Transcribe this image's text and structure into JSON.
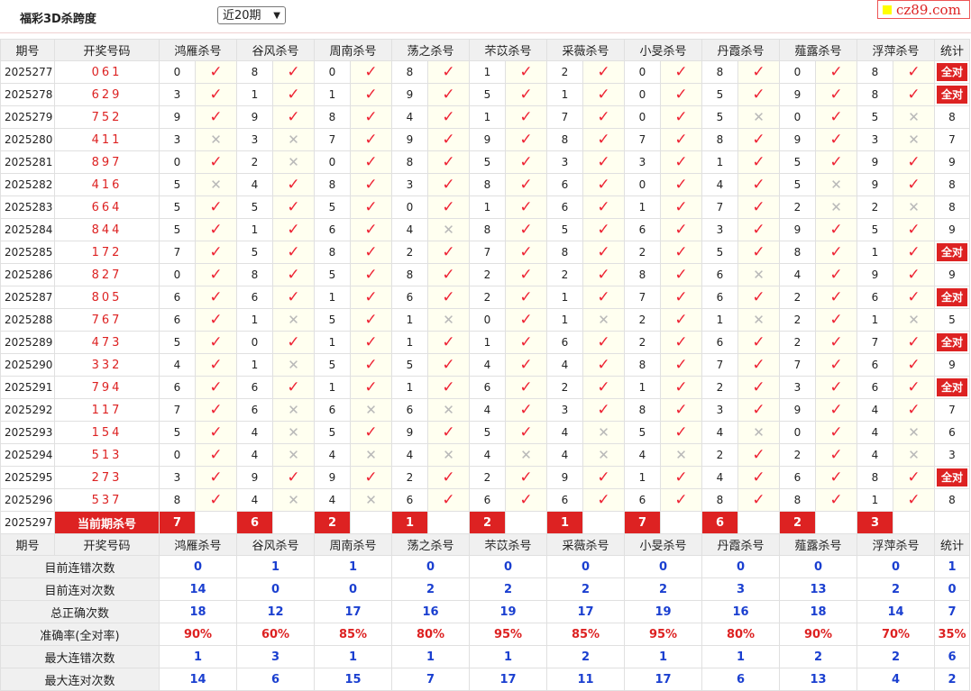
{
  "header": {
    "title": "福彩3D杀跨度",
    "select_value": "近20期",
    "logo_text": "cz89.com"
  },
  "columns": {
    "period": "期号",
    "draw": "开奖号码",
    "experts": [
      "鸿雁杀号",
      "谷风杀号",
      "周南杀号",
      "荡之杀号",
      "芣苡杀号",
      "采薇杀号",
      "小旻杀号",
      "丹霞杀号",
      "薤露杀号",
      "浮萍杀号"
    ],
    "stat": "统计"
  },
  "all_correct_label": "全对",
  "rows": [
    {
      "period": "2025277",
      "draw": "061",
      "kills": [
        [
          0,
          1
        ],
        [
          8,
          1
        ],
        [
          0,
          1
        ],
        [
          8,
          1
        ],
        [
          1,
          1
        ],
        [
          2,
          1
        ],
        [
          0,
          1
        ],
        [
          8,
          1
        ],
        [
          0,
          1
        ],
        [
          8,
          1
        ]
      ],
      "stat": "全对"
    },
    {
      "period": "2025278",
      "draw": "629",
      "kills": [
        [
          3,
          1
        ],
        [
          1,
          1
        ],
        [
          1,
          1
        ],
        [
          9,
          1
        ],
        [
          5,
          1
        ],
        [
          1,
          1
        ],
        [
          0,
          1
        ],
        [
          5,
          1
        ],
        [
          9,
          1
        ],
        [
          8,
          1
        ]
      ],
      "stat": "全对"
    },
    {
      "period": "2025279",
      "draw": "752",
      "kills": [
        [
          9,
          1
        ],
        [
          9,
          1
        ],
        [
          8,
          1
        ],
        [
          4,
          1
        ],
        [
          1,
          1
        ],
        [
          7,
          1
        ],
        [
          0,
          1
        ],
        [
          5,
          0
        ],
        [
          0,
          1
        ],
        [
          5,
          0
        ]
      ],
      "stat": "8"
    },
    {
      "period": "2025280",
      "draw": "411",
      "kills": [
        [
          3,
          0
        ],
        [
          3,
          0
        ],
        [
          7,
          1
        ],
        [
          9,
          1
        ],
        [
          9,
          1
        ],
        [
          8,
          1
        ],
        [
          7,
          1
        ],
        [
          8,
          1
        ],
        [
          9,
          1
        ],
        [
          3,
          0
        ]
      ],
      "stat": "7"
    },
    {
      "period": "2025281",
      "draw": "897",
      "kills": [
        [
          0,
          1
        ],
        [
          2,
          0
        ],
        [
          0,
          1
        ],
        [
          8,
          1
        ],
        [
          5,
          1
        ],
        [
          3,
          1
        ],
        [
          3,
          1
        ],
        [
          1,
          1
        ],
        [
          5,
          1
        ],
        [
          9,
          1
        ]
      ],
      "stat": "9"
    },
    {
      "period": "2025282",
      "draw": "416",
      "kills": [
        [
          5,
          0
        ],
        [
          4,
          1
        ],
        [
          8,
          1
        ],
        [
          3,
          1
        ],
        [
          8,
          1
        ],
        [
          6,
          1
        ],
        [
          0,
          1
        ],
        [
          4,
          1
        ],
        [
          5,
          0
        ],
        [
          9,
          1
        ]
      ],
      "stat": "8"
    },
    {
      "period": "2025283",
      "draw": "664",
      "kills": [
        [
          5,
          1
        ],
        [
          5,
          1
        ],
        [
          5,
          1
        ],
        [
          0,
          1
        ],
        [
          1,
          1
        ],
        [
          6,
          1
        ],
        [
          1,
          1
        ],
        [
          7,
          1
        ],
        [
          2,
          0
        ],
        [
          2,
          0
        ]
      ],
      "stat": "8"
    },
    {
      "period": "2025284",
      "draw": "844",
      "kills": [
        [
          5,
          1
        ],
        [
          1,
          1
        ],
        [
          6,
          1
        ],
        [
          4,
          0
        ],
        [
          8,
          1
        ],
        [
          5,
          1
        ],
        [
          6,
          1
        ],
        [
          3,
          1
        ],
        [
          9,
          1
        ],
        [
          5,
          1
        ]
      ],
      "stat": "9"
    },
    {
      "period": "2025285",
      "draw": "172",
      "kills": [
        [
          7,
          1
        ],
        [
          5,
          1
        ],
        [
          8,
          1
        ],
        [
          2,
          1
        ],
        [
          7,
          1
        ],
        [
          8,
          1
        ],
        [
          2,
          1
        ],
        [
          5,
          1
        ],
        [
          8,
          1
        ],
        [
          1,
          1
        ]
      ],
      "stat": "全对"
    },
    {
      "period": "2025286",
      "draw": "827",
      "kills": [
        [
          0,
          1
        ],
        [
          8,
          1
        ],
        [
          5,
          1
        ],
        [
          8,
          1
        ],
        [
          2,
          1
        ],
        [
          2,
          1
        ],
        [
          8,
          1
        ],
        [
          6,
          0
        ],
        [
          4,
          1
        ],
        [
          9,
          1
        ]
      ],
      "stat": "9"
    },
    {
      "period": "2025287",
      "draw": "805",
      "kills": [
        [
          6,
          1
        ],
        [
          6,
          1
        ],
        [
          1,
          1
        ],
        [
          6,
          1
        ],
        [
          2,
          1
        ],
        [
          1,
          1
        ],
        [
          7,
          1
        ],
        [
          6,
          1
        ],
        [
          2,
          1
        ],
        [
          6,
          1
        ]
      ],
      "stat": "全对"
    },
    {
      "period": "2025288",
      "draw": "767",
      "kills": [
        [
          6,
          1
        ],
        [
          1,
          0
        ],
        [
          5,
          1
        ],
        [
          1,
          0
        ],
        [
          0,
          1
        ],
        [
          1,
          0
        ],
        [
          2,
          1
        ],
        [
          1,
          0
        ],
        [
          2,
          1
        ],
        [
          1,
          0
        ]
      ],
      "stat": "5"
    },
    {
      "period": "2025289",
      "draw": "473",
      "kills": [
        [
          5,
          1
        ],
        [
          0,
          1
        ],
        [
          1,
          1
        ],
        [
          1,
          1
        ],
        [
          1,
          1
        ],
        [
          6,
          1
        ],
        [
          2,
          1
        ],
        [
          6,
          1
        ],
        [
          2,
          1
        ],
        [
          7,
          1
        ]
      ],
      "stat": "全对"
    },
    {
      "period": "2025290",
      "draw": "332",
      "kills": [
        [
          4,
          1
        ],
        [
          1,
          0
        ],
        [
          5,
          1
        ],
        [
          5,
          1
        ],
        [
          4,
          1
        ],
        [
          4,
          1
        ],
        [
          8,
          1
        ],
        [
          7,
          1
        ],
        [
          7,
          1
        ],
        [
          6,
          1
        ]
      ],
      "stat": "9"
    },
    {
      "period": "2025291",
      "draw": "794",
      "kills": [
        [
          6,
          1
        ],
        [
          6,
          1
        ],
        [
          1,
          1
        ],
        [
          1,
          1
        ],
        [
          6,
          1
        ],
        [
          2,
          1
        ],
        [
          1,
          1
        ],
        [
          2,
          1
        ],
        [
          3,
          1
        ],
        [
          6,
          1
        ]
      ],
      "stat": "全对"
    },
    {
      "period": "2025292",
      "draw": "117",
      "kills": [
        [
          7,
          1
        ],
        [
          6,
          0
        ],
        [
          6,
          0
        ],
        [
          6,
          0
        ],
        [
          4,
          1
        ],
        [
          3,
          1
        ],
        [
          8,
          1
        ],
        [
          3,
          1
        ],
        [
          9,
          1
        ],
        [
          4,
          1
        ]
      ],
      "stat": "7"
    },
    {
      "period": "2025293",
      "draw": "154",
      "kills": [
        [
          5,
          1
        ],
        [
          4,
          0
        ],
        [
          5,
          1
        ],
        [
          9,
          1
        ],
        [
          5,
          1
        ],
        [
          4,
          0
        ],
        [
          5,
          1
        ],
        [
          4,
          0
        ],
        [
          0,
          1
        ],
        [
          4,
          0
        ]
      ],
      "stat": "6"
    },
    {
      "period": "2025294",
      "draw": "513",
      "kills": [
        [
          0,
          1
        ],
        [
          4,
          0
        ],
        [
          4,
          0
        ],
        [
          4,
          0
        ],
        [
          4,
          0
        ],
        [
          4,
          0
        ],
        [
          4,
          0
        ],
        [
          2,
          1
        ],
        [
          2,
          1
        ],
        [
          4,
          0
        ]
      ],
      "stat": "3"
    },
    {
      "period": "2025295",
      "draw": "273",
      "kills": [
        [
          3,
          1
        ],
        [
          9,
          1
        ],
        [
          9,
          1
        ],
        [
          2,
          1
        ],
        [
          2,
          1
        ],
        [
          9,
          1
        ],
        [
          1,
          1
        ],
        [
          4,
          1
        ],
        [
          6,
          1
        ],
        [
          8,
          1
        ]
      ],
      "stat": "全对"
    },
    {
      "period": "2025296",
      "draw": "537",
      "kills": [
        [
          8,
          1
        ],
        [
          4,
          0
        ],
        [
          4,
          0
        ],
        [
          6,
          1
        ],
        [
          6,
          1
        ],
        [
          6,
          1
        ],
        [
          6,
          1
        ],
        [
          8,
          1
        ],
        [
          8,
          1
        ],
        [
          1,
          1
        ]
      ],
      "stat": "8"
    }
  ],
  "current": {
    "period": "2025297",
    "label": "当前期杀号",
    "kills": [
      "7",
      "6",
      "2",
      "1",
      "2",
      "1",
      "7",
      "6",
      "2",
      "3"
    ]
  },
  "stats_header": {
    "period": "期号",
    "draw": "开奖号码",
    "stat": "统计"
  },
  "stats": [
    {
      "label": "目前连错次数",
      "values": [
        "0",
        "1",
        "1",
        "0",
        "0",
        "0",
        "0",
        "0",
        "0",
        "0"
      ],
      "stat": "1",
      "red": false
    },
    {
      "label": "目前连对次数",
      "values": [
        "14",
        "0",
        "0",
        "2",
        "2",
        "2",
        "2",
        "3",
        "13",
        "2"
      ],
      "stat": "0",
      "red": false
    },
    {
      "label": "总正确次数",
      "values": [
        "18",
        "12",
        "17",
        "16",
        "19",
        "17",
        "19",
        "16",
        "18",
        "14"
      ],
      "stat": "7",
      "red": false
    },
    {
      "label": "准确率(全对率)",
      "values": [
        "90%",
        "60%",
        "85%",
        "80%",
        "95%",
        "85%",
        "95%",
        "80%",
        "90%",
        "70%"
      ],
      "stat": "35%",
      "red": true
    },
    {
      "label": "最大连错次数",
      "values": [
        "1",
        "3",
        "1",
        "1",
        "1",
        "2",
        "1",
        "1",
        "2",
        "2"
      ],
      "stat": "6",
      "red": false
    },
    {
      "label": "最大连对次数",
      "values": [
        "14",
        "6",
        "15",
        "7",
        "17",
        "11",
        "17",
        "6",
        "13",
        "4"
      ],
      "stat": "2",
      "red": false
    }
  ],
  "icons": {
    "correct": "check-icon",
    "wrong": "cross-icon"
  },
  "colors": {
    "accent": "#dd2222",
    "value_blue": "#1a3fd0"
  }
}
